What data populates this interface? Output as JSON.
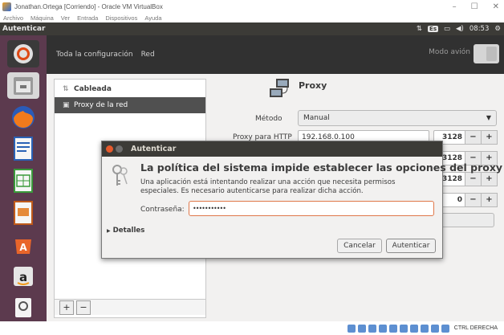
{
  "host": {
    "title": "Jonathan.Ortega [Corriendo] - Oracle VM VirtualBox",
    "controls": {
      "minimize": "–",
      "maximize": "☐",
      "close": "✕"
    },
    "menu": [
      "Archivo",
      "Máquina",
      "Ver",
      "Entrada",
      "Dispositivos",
      "Ayuda"
    ],
    "status_host_key": "CTRL DERECHA"
  },
  "panel": {
    "app_name": "Autenticar",
    "keyboard": "Es",
    "time": "08:53",
    "icons": [
      "network-icon",
      "keyboard-layout-icon",
      "battery-icon",
      "volume-icon",
      "power-icon"
    ]
  },
  "settings": {
    "all_settings": "Toda la configuración",
    "network": "Red",
    "airplane_mode": "Modo avión",
    "sidebar": {
      "wired": "Cableada",
      "proxy": "Proxy de la red",
      "add": "+",
      "remove": "−"
    },
    "proxy": {
      "title": "Proxy",
      "method_label": "Método",
      "method_value": "Manual",
      "http_label": "Proxy para HTTP",
      "http_value": "192.168.0.100",
      "ports": [
        "3128",
        "3128",
        "3128",
        "0"
      ],
      "minus": "−",
      "plus": "+"
    }
  },
  "dialog": {
    "title": "Autenticar",
    "heading": "La política del sistema impide establecer las opciones del proxy",
    "message": "Una aplicación está intentando realizar una acción que necesita permisos especiales. Es necesario autenticarse para realizar dicha acción.",
    "password_label": "Contraseña:",
    "password_value": "•••••••••••",
    "details": "Detalles",
    "cancel": "Cancelar",
    "authenticate": "Autenticar"
  },
  "colors": {
    "panel": "#3c3b37",
    "launcher": "#5c3a4e",
    "accent": "#e65a2c",
    "selection": "#505050"
  }
}
